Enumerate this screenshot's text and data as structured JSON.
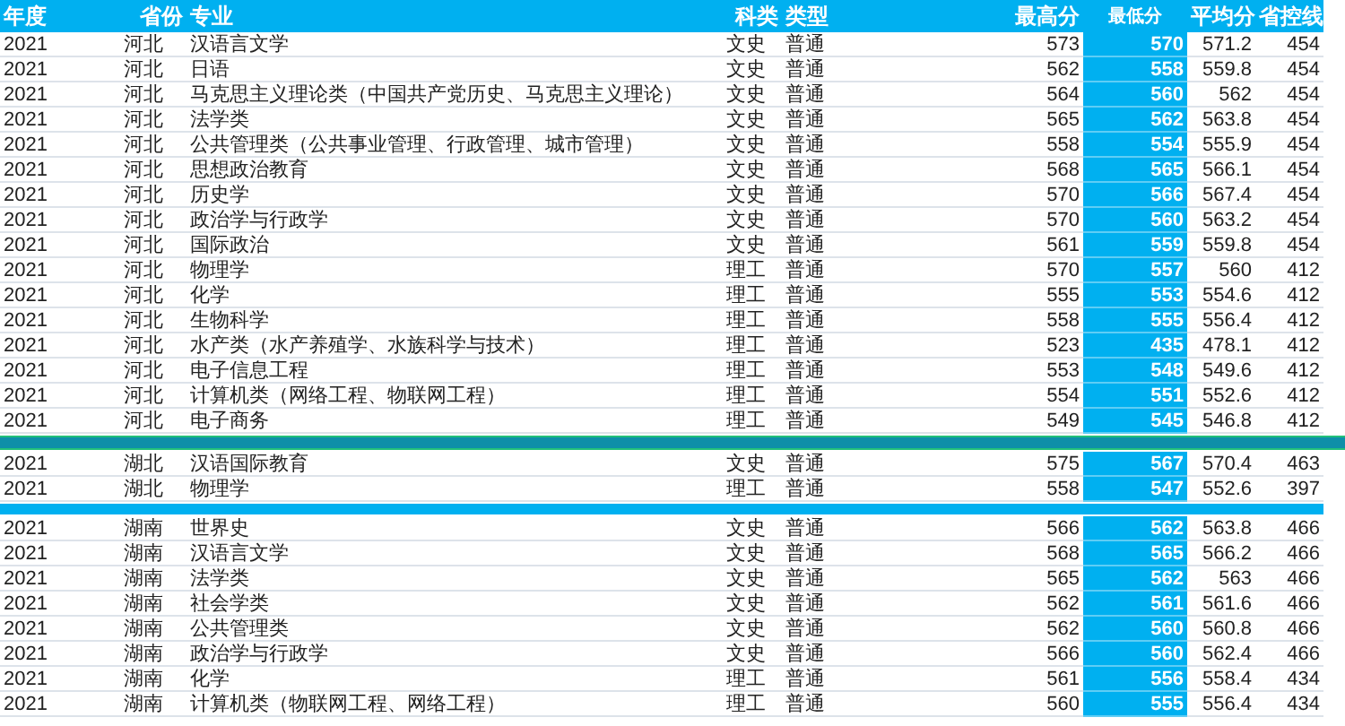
{
  "columns": [
    "年度",
    "省份",
    "专业",
    "科类",
    "类型",
    "最高分",
    "最低分",
    "平均分",
    "省控线"
  ],
  "groups": [
    {
      "rows": [
        {
          "year": "2021",
          "province": "河北",
          "major": "汉语言文学",
          "subject": "文史",
          "type": "普通",
          "max": "573",
          "min": "570",
          "avg": "571.2",
          "line": "454"
        },
        {
          "year": "2021",
          "province": "河北",
          "major": "日语",
          "subject": "文史",
          "type": "普通",
          "max": "562",
          "min": "558",
          "avg": "559.8",
          "line": "454"
        },
        {
          "year": "2021",
          "province": "河北",
          "major": "马克思主义理论类（中国共产党历史、马克思主义理论）",
          "subject": "文史",
          "type": "普通",
          "max": "564",
          "min": "560",
          "avg": "562",
          "line": "454"
        },
        {
          "year": "2021",
          "province": "河北",
          "major": "法学类",
          "subject": "文史",
          "type": "普通",
          "max": "565",
          "min": "562",
          "avg": "563.8",
          "line": "454"
        },
        {
          "year": "2021",
          "province": "河北",
          "major": "公共管理类（公共事业管理、行政管理、城市管理）",
          "subject": "文史",
          "type": "普通",
          "max": "558",
          "min": "554",
          "avg": "555.9",
          "line": "454"
        },
        {
          "year": "2021",
          "province": "河北",
          "major": "思想政治教育",
          "subject": "文史",
          "type": "普通",
          "max": "568",
          "min": "565",
          "avg": "566.1",
          "line": "454"
        },
        {
          "year": "2021",
          "province": "河北",
          "major": "历史学",
          "subject": "文史",
          "type": "普通",
          "max": "570",
          "min": "566",
          "avg": "567.4",
          "line": "454"
        },
        {
          "year": "2021",
          "province": "河北",
          "major": "政治学与行政学",
          "subject": "文史",
          "type": "普通",
          "max": "570",
          "min": "560",
          "avg": "563.2",
          "line": "454"
        },
        {
          "year": "2021",
          "province": "河北",
          "major": "国际政治",
          "subject": "文史",
          "type": "普通",
          "max": "561",
          "min": "559",
          "avg": "559.8",
          "line": "454"
        },
        {
          "year": "2021",
          "province": "河北",
          "major": "物理学",
          "subject": "理工",
          "type": "普通",
          "max": "570",
          "min": "557",
          "avg": "560",
          "line": "412"
        },
        {
          "year": "2021",
          "province": "河北",
          "major": "化学",
          "subject": "理工",
          "type": "普通",
          "max": "555",
          "min": "553",
          "avg": "554.6",
          "line": "412"
        },
        {
          "year": "2021",
          "province": "河北",
          "major": "生物科学",
          "subject": "理工",
          "type": "普通",
          "max": "558",
          "min": "555",
          "avg": "556.4",
          "line": "412"
        },
        {
          "year": "2021",
          "province": "河北",
          "major": "水产类（水产养殖学、水族科学与技术）",
          "subject": "理工",
          "type": "普通",
          "max": "523",
          "min": "435",
          "avg": "478.1",
          "line": "412"
        },
        {
          "year": "2021",
          "province": "河北",
          "major": "电子信息工程",
          "subject": "理工",
          "type": "普通",
          "max": "553",
          "min": "548",
          "avg": "549.6",
          "line": "412"
        },
        {
          "year": "2021",
          "province": "河北",
          "major": "计算机类（网络工程、物联网工程）",
          "subject": "理工",
          "type": "普通",
          "max": "554",
          "min": "551",
          "avg": "552.6",
          "line": "412"
        },
        {
          "year": "2021",
          "province": "河北",
          "major": "电子商务",
          "subject": "理工",
          "type": "普通",
          "max": "549",
          "min": "545",
          "avg": "546.8",
          "line": "412"
        }
      ]
    },
    {
      "color": "#0e8fa8",
      "rows": [
        {
          "year": "2021",
          "province": "湖北",
          "major": "汉语国际教育",
          "subject": "文史",
          "type": "普通",
          "max": "575",
          "min": "567",
          "avg": "570.4",
          "line": "463"
        },
        {
          "year": "2021",
          "province": "湖北",
          "major": "物理学",
          "subject": "理工",
          "type": "普通",
          "max": "558",
          "min": "547",
          "avg": "552.6",
          "line": "397"
        }
      ]
    },
    {
      "color": "#00b0f0",
      "rows": [
        {
          "year": "2021",
          "province": "湖南",
          "major": "世界史",
          "subject": "文史",
          "type": "普通",
          "max": "566",
          "min": "562",
          "avg": "563.8",
          "line": "466"
        },
        {
          "year": "2021",
          "province": "湖南",
          "major": "汉语言文学",
          "subject": "文史",
          "type": "普通",
          "max": "568",
          "min": "565",
          "avg": "566.2",
          "line": "466"
        },
        {
          "year": "2021",
          "province": "湖南",
          "major": "法学类",
          "subject": "文史",
          "type": "普通",
          "max": "565",
          "min": "562",
          "avg": "563",
          "line": "466"
        },
        {
          "year": "2021",
          "province": "湖南",
          "major": "社会学类",
          "subject": "文史",
          "type": "普通",
          "max": "562",
          "min": "561",
          "avg": "561.6",
          "line": "466"
        },
        {
          "year": "2021",
          "province": "湖南",
          "major": "公共管理类",
          "subject": "文史",
          "type": "普通",
          "max": "562",
          "min": "560",
          "avg": "560.8",
          "line": "466"
        },
        {
          "year": "2021",
          "province": "湖南",
          "major": "政治学与行政学",
          "subject": "文史",
          "type": "普通",
          "max": "566",
          "min": "560",
          "avg": "562.4",
          "line": "466"
        },
        {
          "year": "2021",
          "province": "湖南",
          "major": "化学",
          "subject": "理工",
          "type": "普通",
          "max": "561",
          "min": "556",
          "avg": "558.4",
          "line": "434"
        },
        {
          "year": "2021",
          "province": "湖南",
          "major": "计算机类（物联网工程、网络工程）",
          "subject": "理工",
          "type": "普通",
          "max": "560",
          "min": "555",
          "avg": "556.4",
          "line": "434"
        }
      ]
    }
  ]
}
